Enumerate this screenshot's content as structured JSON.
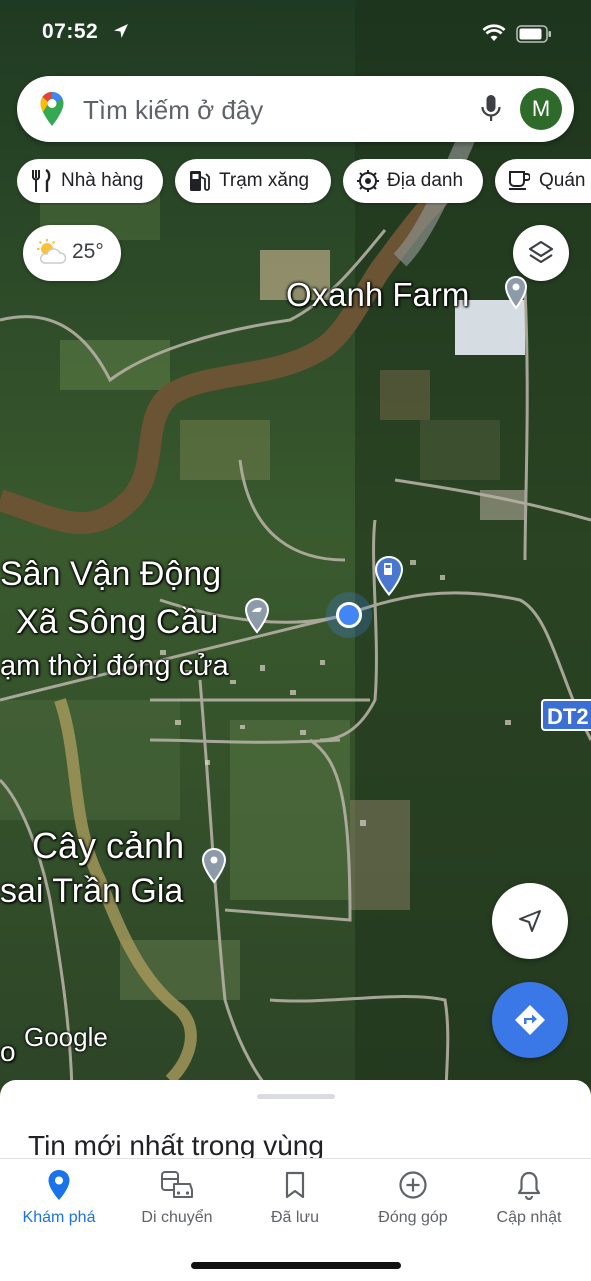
{
  "status_bar": {
    "time": "07:52"
  },
  "search": {
    "placeholder": "Tìm kiếm ở đây",
    "avatar_initial": "M"
  },
  "chips": [
    {
      "label": "Nhà hàng",
      "icon": "restaurant-icon"
    },
    {
      "label": "Trạm xăng",
      "icon": "gas-station-icon"
    },
    {
      "label": "Địa danh",
      "icon": "landmark-icon"
    },
    {
      "label": "Quán",
      "icon": "cafe-icon"
    }
  ],
  "weather": {
    "temperature": "25°",
    "icon": "partly-sunny-icon"
  },
  "map": {
    "labels": {
      "oxanh": "Oxanh Farm",
      "svd_line1": "Sân Vận Động",
      "svd_line2": "Xã Sông Cầu",
      "svd_line3": "ạm thời đóng cửa",
      "caycanh_line1": "Cây cảnh",
      "caycanh_line2": "sai Trần Gia",
      "road_shield": "DT2",
      "left_fragment": "o"
    },
    "attribution": "Google"
  },
  "sheet": {
    "title": "Tin mới nhất trong vùng"
  },
  "bottom_nav": {
    "tabs": [
      {
        "label": "Khám phá",
        "icon": "explore-pin-icon",
        "active": true
      },
      {
        "label": "Di chuyển",
        "icon": "commute-icon",
        "active": false
      },
      {
        "label": "Đã lưu",
        "icon": "bookmark-icon",
        "active": false
      },
      {
        "label": "Đóng góp",
        "icon": "add-circle-icon",
        "active": false
      },
      {
        "label": "Cập nhật",
        "icon": "bell-icon",
        "active": false
      }
    ]
  },
  "colors": {
    "accent": "#1a73e8",
    "avatar": "#2e6b2a",
    "road_shield": "#3b6fd4"
  }
}
